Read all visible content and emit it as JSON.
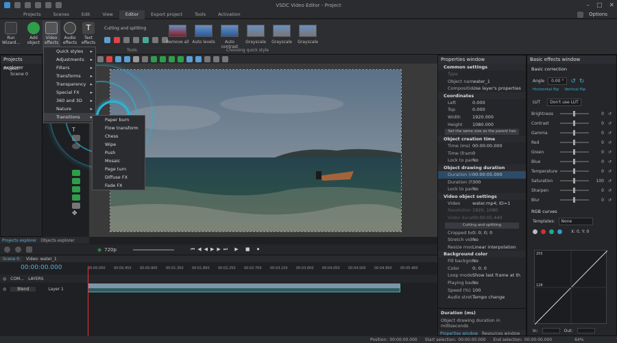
{
  "window": {
    "title": "VSDC Video Editor - Project",
    "options_label": "Options"
  },
  "menu": [
    "Projects",
    "Scenes",
    "Edit",
    "View",
    "Editor",
    "Export project",
    "Tools",
    "Activation"
  ],
  "ribbon": {
    "run_wizard": "Run Wizard...",
    "add_object": "Add object",
    "video_effects": "Video effects",
    "audio_effects": "Audio effects",
    "text_effects": "Text effects",
    "cutting_label": "Cutting and splitting",
    "tools_label": "Tools",
    "quick_style_label": "Choosing quick style",
    "quick_styles": [
      "Remove all",
      "Auto levels",
      "Auto contrast",
      "Grayscale",
      "Grayscale",
      "Grayscale"
    ]
  },
  "effects_menu": {
    "items": [
      "Quick styles",
      "Adjustments",
      "Filters",
      "Transforms",
      "Transparency",
      "Special FX",
      "360 and 3D",
      "Nature",
      "Transitions"
    ],
    "selected": "Transitions"
  },
  "transitions_submenu": [
    "Paper burn",
    "Flow transform",
    "Chess",
    "Wipe",
    "Push",
    "Mosaic",
    "Page turn",
    "Diffuse FX",
    "Fade FX"
  ],
  "projects_explorer": {
    "title": "Projects explorer",
    "tree": [
      "Project",
      "Scene 0"
    ],
    "tabs": [
      "Projects explorer",
      "Objects explorer"
    ]
  },
  "properties": {
    "title": "Properties window",
    "common_settings": "Common settings",
    "type_label": "Type",
    "object_name_label": "Object name",
    "object_name": "water_1",
    "composition_label": "Composition mod",
    "composition": "Use layer's properties",
    "coordinates": "Coordinates",
    "coords": [
      [
        "Left",
        "0.000"
      ],
      [
        "Top",
        "0.000"
      ],
      [
        "Width",
        "1920.000"
      ],
      [
        "Height",
        "1080.000"
      ]
    ],
    "same_size_btn": "Set the same size as the parent has",
    "creation_time": "Object creation time",
    "creation": [
      [
        "Time (ms)",
        "00:00:00.000"
      ],
      [
        "Time (frame)",
        "0"
      ],
      [
        "Lock to parent",
        "No"
      ]
    ],
    "drawing_duration": "Object drawing duration",
    "duration": [
      [
        "Duration (ms)",
        "00:00:05.000"
      ],
      [
        "Duration (frame",
        "300"
      ],
      [
        "Lock to parent",
        "No"
      ]
    ],
    "video_settings": "Video object settings",
    "video_label": "Video",
    "video_value": "water.mp4; ID=1",
    "resolution_label": "Resolution",
    "resolution": "1920, 1080",
    "video_duration_label": "Video duration",
    "video_duration": "00:00:05.440",
    "cutting_btn": "Cutting and splitting",
    "misc": [
      [
        "Cropped borders",
        "0; 0; 0; 0"
      ],
      [
        "Stretch video",
        "No"
      ],
      [
        "Resize mode",
        "Linear interpolation"
      ]
    ],
    "bg_color": "Background color",
    "bg": [
      [
        "Fill background",
        "No"
      ],
      [
        "Color",
        "0; 0; 0"
      ]
    ],
    "more": [
      [
        "Loop mode",
        "Show last frame at th"
      ],
      [
        "Playing backwards",
        "No"
      ],
      [
        "Speed (%)",
        "100"
      ],
      [
        "Audio stretching m",
        "Tempo change"
      ]
    ],
    "desc_title": "Duration (ms)",
    "desc_text": "Object drawing duration in milliseconds",
    "tabs": [
      "Properties window",
      "Resources window"
    ]
  },
  "basic_effects": {
    "title": "Basic effects window",
    "basic_correction": "Basic correction",
    "angle_label": "Angle",
    "angle_value": "0.00 °",
    "flip_h": "Horizontal flip",
    "flip_v": "Vertical flip",
    "lut_label": "LUT",
    "lut_value": "Don't use LUT",
    "sliders": [
      [
        "Brightness",
        "0"
      ],
      [
        "Contrast",
        "0"
      ],
      [
        "Gamma",
        "0"
      ],
      [
        "Red",
        "0"
      ],
      [
        "Green",
        "0"
      ],
      [
        "Blue",
        "0"
      ],
      [
        "Temperature",
        "0"
      ],
      [
        "Saturation",
        "100"
      ],
      [
        "Sharpen",
        "0"
      ],
      [
        "Blur",
        "0"
      ]
    ],
    "rgb_curves": "RGB curves",
    "templates_label": "Templates:",
    "templates_value": "None",
    "xy": "X: 0, Y: 0",
    "curve_labels": [
      "255",
      "128"
    ],
    "in_label": "In:",
    "out_label": "Out:"
  },
  "timeline": {
    "resolution": "720p",
    "scene_tab": "Scene 0",
    "video_tab": "Video: water_1",
    "timecode": "00:00:00.000",
    "ticks": [
      "00:00.000",
      "00:00.450",
      "00:00.900",
      "00:01.350",
      "00:01.800",
      "00:02.250",
      "00:02.700",
      "00:03.150",
      "00:03.600",
      "00:04.050",
      "00:04.500",
      "00:04.950",
      "00:05.400"
    ],
    "com_label": "COM...",
    "layers_label": "LAYERS",
    "blend_label": "Blend",
    "layer_label": "Layer 1"
  },
  "status": {
    "position": "Position:",
    "position_val": "00:00:00.000",
    "start_sel": "Start selection:",
    "start_val": "00:00:00.000",
    "end_sel": "End selection:",
    "end_val": "00:00:00.000",
    "zoom": "64%"
  },
  "colors": {
    "accent": "#29b6d6",
    "bg": "#1e1f22",
    "panel": "#25262a"
  }
}
